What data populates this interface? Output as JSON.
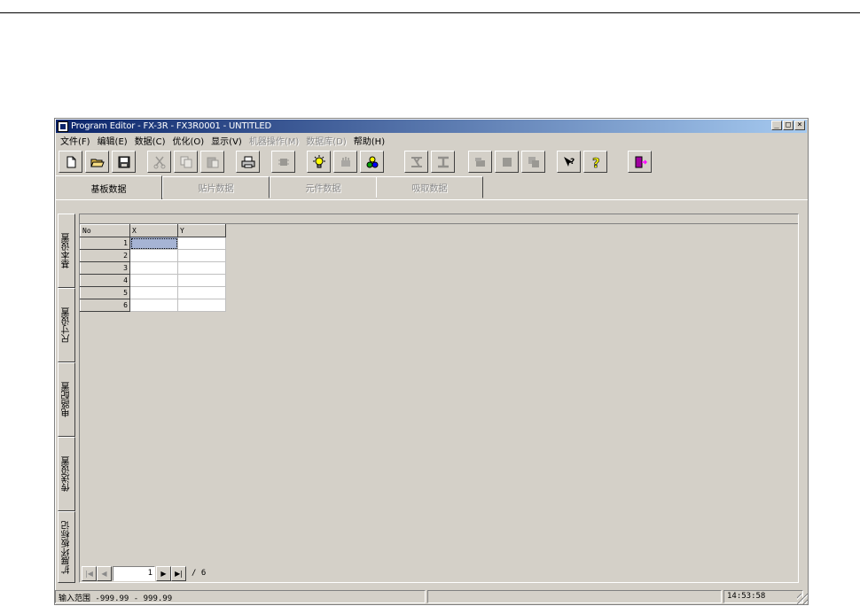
{
  "window": {
    "title": "Program Editor - FX-3R - FX3R0001 - UNTITLED"
  },
  "window_buttons": {
    "minimize": "_",
    "maximize": "□",
    "close": "×"
  },
  "menu": [
    {
      "label": "文件(F)",
      "enabled": true
    },
    {
      "label": "编辑(E)",
      "enabled": true
    },
    {
      "label": "数据(C)",
      "enabled": true
    },
    {
      "label": "优化(O)",
      "enabled": true
    },
    {
      "label": "显示(V)",
      "enabled": true
    },
    {
      "label": "机器操作(M)",
      "enabled": false
    },
    {
      "label": "数据库(D)",
      "enabled": false
    },
    {
      "label": "帮助(H)",
      "enabled": true
    }
  ],
  "toolbar": [
    {
      "icon": "new-file-icon"
    },
    {
      "icon": "open-folder-icon"
    },
    {
      "icon": "save-disk-icon"
    },
    {
      "icon": "cut-icon"
    },
    {
      "icon": "copy-icon"
    },
    {
      "icon": "paste-icon"
    },
    {
      "icon": "print-icon"
    },
    {
      "icon": "component-icon"
    },
    {
      "icon": "lightbulb-icon"
    },
    {
      "icon": "feeder-icon"
    },
    {
      "icon": "color-balls-icon"
    },
    {
      "icon": "align-icon"
    },
    {
      "icon": "i-beam-icon"
    },
    {
      "icon": "stamp-icon"
    },
    {
      "icon": "square-icon"
    },
    {
      "icon": "layers-icon"
    },
    {
      "icon": "context-help-icon"
    },
    {
      "icon": "help-icon"
    },
    {
      "icon": "exit-door-icon"
    }
  ],
  "tabs": [
    {
      "label": "基板数据",
      "active": true
    },
    {
      "label": "贴片数据",
      "active": false
    },
    {
      "label": "元件数据",
      "active": false
    },
    {
      "label": "吸取数据",
      "active": false
    }
  ],
  "side_tabs": [
    {
      "label": "基本设置"
    },
    {
      "label": "尺寸设置"
    },
    {
      "label": "电路配置"
    },
    {
      "label": "传送设置"
    },
    {
      "label": "扩展坏板标记"
    }
  ],
  "grid": {
    "headers": [
      "No",
      "X",
      "Y"
    ],
    "rows": [
      {
        "no": "1",
        "x": "",
        "y": ""
      },
      {
        "no": "2",
        "x": "",
        "y": ""
      },
      {
        "no": "3",
        "x": "",
        "y": ""
      },
      {
        "no": "4",
        "x": "",
        "y": ""
      },
      {
        "no": "5",
        "x": "",
        "y": ""
      },
      {
        "no": "6",
        "x": "",
        "y": ""
      }
    ]
  },
  "pager": {
    "first": "|◀",
    "prev": "◀",
    "next": "▶",
    "last": "▶|",
    "current_page": "1",
    "total": "/ 6"
  },
  "status": {
    "message": "输入范围 -999.99 - 999.99",
    "time": "14:53:58"
  }
}
